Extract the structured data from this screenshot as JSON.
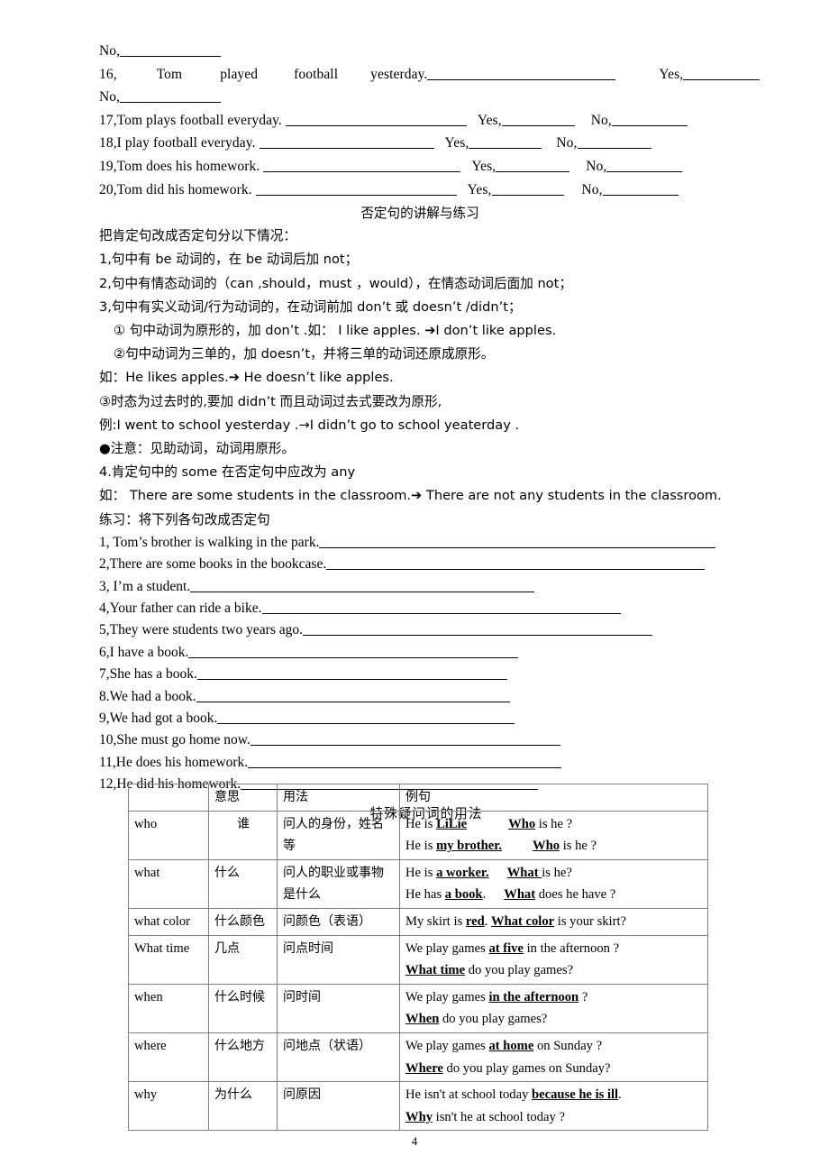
{
  "document": {
    "page_number": "4"
  },
  "top_questions": {
    "line_no_0": "No,",
    "q16": {
      "number": "16,",
      "words": [
        "Tom",
        "played",
        "football",
        "yesterday."
      ],
      "yes": "Yes,",
      "no_next": "No,"
    },
    "q17": {
      "text": "17,Tom plays football everyday.",
      "yes": "Yes,",
      "no": "No,"
    },
    "q18": {
      "text": "18,I play football everyday.",
      "yes": "Yes,",
      "no": "No,"
    },
    "q19": {
      "text": "19,Tom does his homework.",
      "yes": "Yes,",
      "no": "No,"
    },
    "q20": {
      "text": "20,Tom did his homework.",
      "yes": "Yes,",
      "no": "No,"
    }
  },
  "negation_section": {
    "title": "否定句的讲解与练习",
    "intro": "把肯定句改成否定句分以下情况：",
    "rules": [
      "1,句中有 be 动词的，在 be 动词后加 not；",
      "2,句中有情态动词的（can ,should，must ，would），在情态动词后面加 not；",
      "3,句中有实义动词/行为动词的，在动词前加 don’t 或 doesn’t /didn’t；"
    ],
    "sub_rules": [
      "① 句中动词为原形的，加 don’t .如： I like apples. ➔I don’t like apples.",
      "②句中动词为三单的，加 doesn’t，并将三单的动词还原成原形。"
    ],
    "example_1": "如：He likes apples.➔ He doesn’t like apples.",
    "rule_3c": "③时态为过去时的,要加 didn’t 而且动词过去式要改为原形,",
    "example_2": "例:I went to school yesterday .→I didn’t go to school yeaterday .",
    "note": "●注意：见助动词，动词用原形。",
    "rule_4": "4.肯定句中的 some 在否定句中应改为 any",
    "example_3": "如： There are some students in the classroom.➔ There are not any students in the classroom.",
    "practice_heading": "练习：将下列各句改成否定句"
  },
  "practice_items": [
    {
      "text": "1, Tom’s brother is walking in the park.",
      "blank_width": 440
    },
    {
      "text": "2,There are some books in the bookcase.",
      "blank_width": 420
    },
    {
      "text": "3, I’m a student.",
      "blank_width": 382
    },
    {
      "text": "4,Your father can ride a bike.",
      "blank_width": 398
    },
    {
      "text": "5,They were students two years ago.",
      "blank_width": 388
    },
    {
      "text": "6,I have a book.",
      "blank_width": 366
    },
    {
      "text": "7,She has a book.",
      "blank_width": 344
    },
    {
      "text": "8.We had a book.",
      "blank_width": 348
    },
    {
      "text": "9,We had got a book.",
      "blank_width": 330
    },
    {
      "text": "10,She must go home now.",
      "blank_width": 344
    },
    {
      "text": "11,He does his homework.",
      "blank_width": 348
    },
    {
      "text": "12,He did his homework.",
      "blank_width": 330
    }
  ],
  "table_section": {
    "title": "特殊疑问词的用法",
    "headers": [
      "",
      "意思",
      "用法",
      "例句"
    ],
    "rows": [
      {
        "word": "who",
        "meaning": "谁",
        "usage": "问人的身份，姓名等",
        "examples": [
          {
            "pre": "He is ",
            "bold1": "LiLie",
            "mid": "",
            "gap": "gap-l",
            "bold2": "Who",
            "post": " is he ?"
          },
          {
            "pre": "He is ",
            "bold1": "my brother.",
            "mid": "",
            "gap": "gap-m",
            "bold2": "Who",
            "post": " is he ?"
          }
        ]
      },
      {
        "word": "what",
        "meaning": "什么",
        "usage": "问人的职业或事物是什么",
        "examples": [
          {
            "pre": "He is ",
            "bold1": "a worker.",
            "mid": "",
            "gap": "gap-s",
            "bold2": "What ",
            "post": "is he?"
          },
          {
            "pre": "He has ",
            "bold1": "a book",
            "mid": ".",
            "gap": "gap-s",
            "bold2": "What",
            "post": " does he have ?"
          }
        ]
      },
      {
        "word": "what color",
        "meaning": "什么颜色",
        "usage": "问颜色（表语）",
        "examples": [
          {
            "pre": "My skirt is ",
            "bold1": "red",
            "mid": ". ",
            "gap": "",
            "bold2": "What color",
            "post": " is your skirt?"
          }
        ]
      },
      {
        "word": "What time",
        "meaning": "几点",
        "usage": "问点时间",
        "examples": [
          {
            "pre": "We play games ",
            "bold1": "at five",
            "mid": " in the afternoon ?",
            "gap": "",
            "bold2": "",
            "post": ""
          },
          {
            "pre": "",
            "bold1": "",
            "mid": "",
            "gap": "",
            "bold2": "What time",
            "post": " do you play games?"
          }
        ]
      },
      {
        "word": "when",
        "meaning": "什么时候",
        "usage": "问时间",
        "examples": [
          {
            "pre": "We play games ",
            "bold1": "in the afternoon",
            "mid": " ?",
            "gap": "",
            "bold2": "",
            "post": ""
          },
          {
            "pre": "",
            "bold1": "",
            "mid": "",
            "gap": "",
            "bold2": "When",
            "post": " do you play games?"
          }
        ]
      },
      {
        "word": "where",
        "meaning": "什么地方",
        "usage": "问地点（状语）",
        "examples": [
          {
            "pre": "We play games ",
            "bold1": "at home",
            "mid": " on Sunday ?",
            "gap": "",
            "bold2": "",
            "post": ""
          },
          {
            "pre": "",
            "bold1": "",
            "mid": "",
            "gap": "",
            "bold2": "Where",
            "post": " do you play games on Sunday?"
          }
        ]
      },
      {
        "word": "why",
        "meaning": "为什么",
        "usage": "问原因",
        "examples": [
          {
            "pre": "He isn't at school today ",
            "bold1": "because he is ill",
            "mid": ".",
            "gap": "",
            "bold2": "",
            "post": ""
          },
          {
            "pre": "",
            "bold1": "",
            "mid": "",
            "gap": "",
            "bold2": "Why",
            "post": " isn't he at school today ?"
          }
        ]
      }
    ]
  }
}
